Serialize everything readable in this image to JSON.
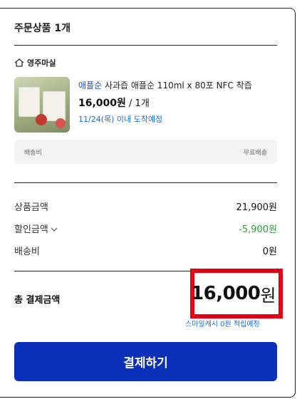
{
  "order": {
    "section_title": "주문상품 1개",
    "store_name": "영주마실",
    "product": {
      "brand": "애플순",
      "name": " 사과즙 애플순 110ml x 80포 NFC 착즙",
      "price": "16,000원",
      "quantity": " / 1개",
      "delivery_estimate": "11/24(목) 이내 도착예정"
    },
    "shipping": {
      "label": "배송비",
      "value": "무료배송"
    }
  },
  "summary": {
    "product_amount_label": "상품금액",
    "product_amount_value": "21,900원",
    "discount_label": "할인금액",
    "discount_value": "-5,900원",
    "shipping_label": "배송비",
    "shipping_value": "0원"
  },
  "total": {
    "label": "총 결제금액",
    "amount": "16,000",
    "unit": "원",
    "points_note": "스마일캐시 0원 적립예정"
  },
  "pay_button_label": "결제하기",
  "colors": {
    "accent": "#0a2fb8",
    "discount": "#2e9e3a",
    "highlight": "#e60012",
    "link": "#1a6fe0"
  }
}
